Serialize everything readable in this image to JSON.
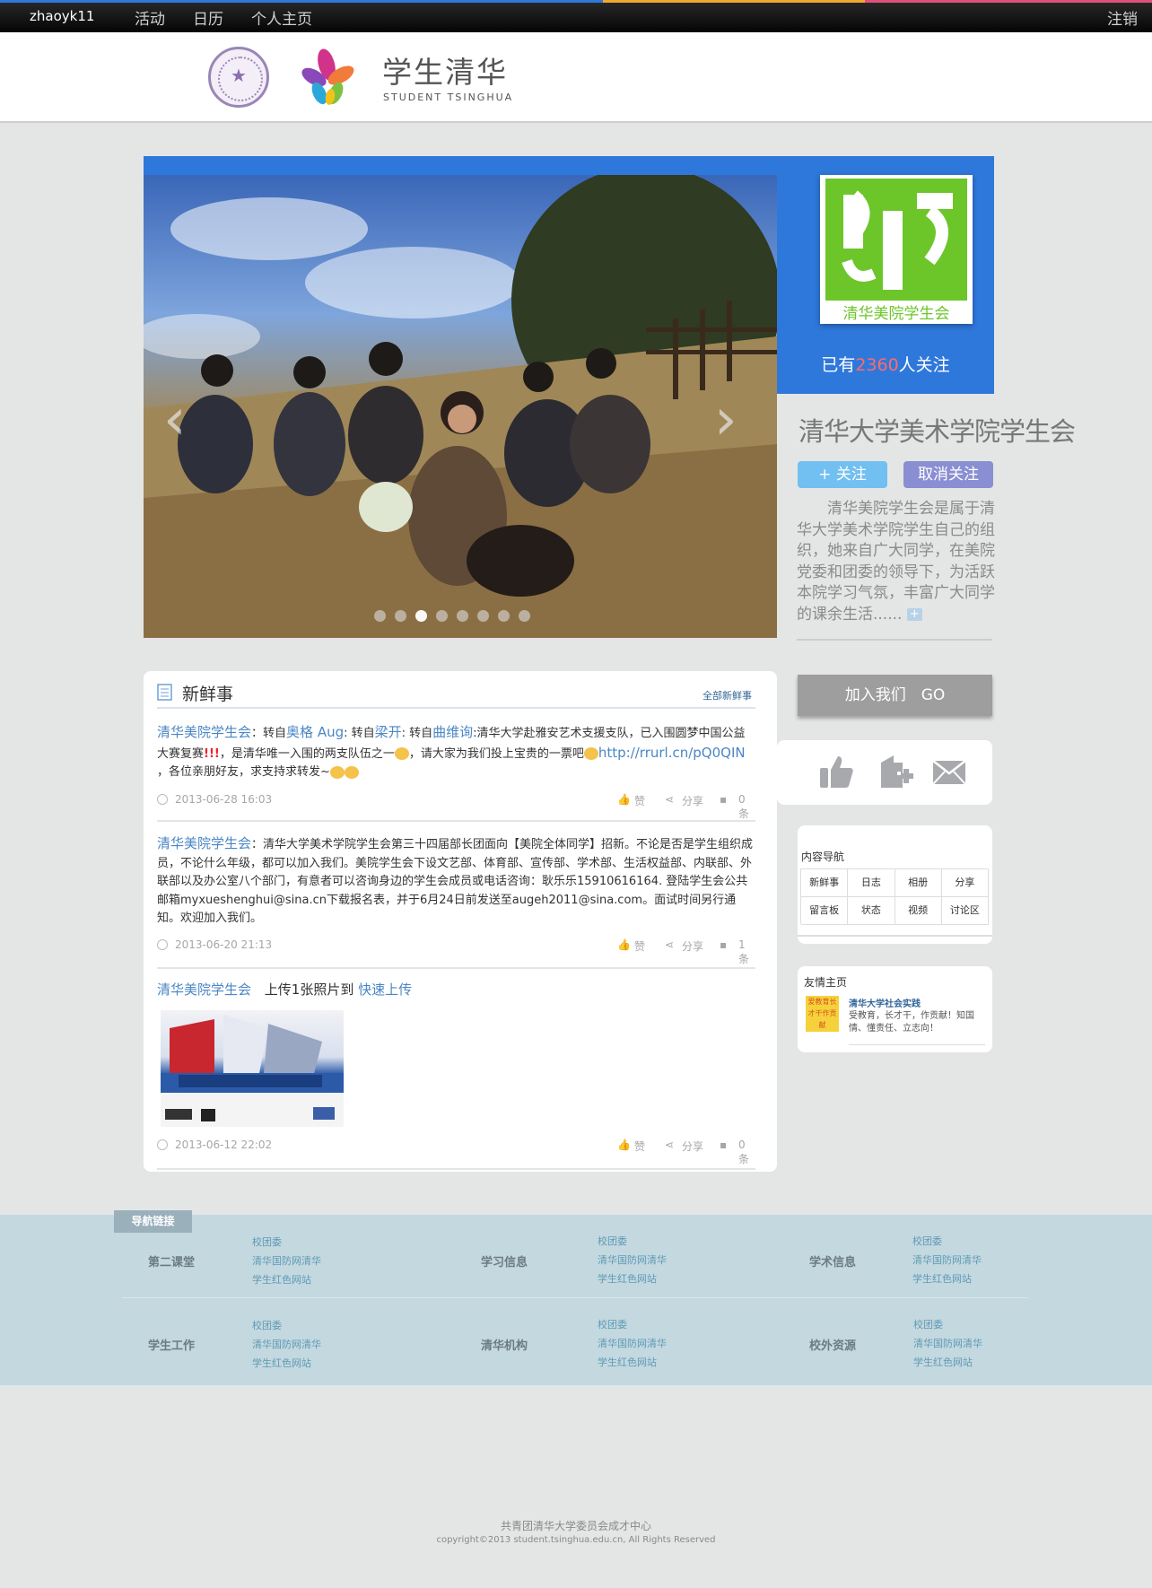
{
  "topbar": {
    "username": "zhaoyk11",
    "nav": [
      "活动",
      "日历",
      "个人主页"
    ],
    "logout": "注销",
    "stripe_colors": [
      "#2f78db",
      "#f0a830",
      "#e0507a"
    ]
  },
  "header": {
    "brand_cn": "学生清华",
    "brand_en": "STUDENT TSINGHUA"
  },
  "profile": {
    "avatar_text": "清华美院学生会",
    "follow_prefix": "已有",
    "follow_count": "2360",
    "follow_suffix": "人关注",
    "org_name": "清华大学美术学院学生会",
    "follow_button": "+ 关注",
    "unfollow_button": "取消关注",
    "intro": "清华美院学生会是属于清华大学美术学院学生自己的组织，她来自广大同学，在美院党委和团委的领导下，为活跃本院学习气氛，丰富广大同学的课余生活......",
    "more_icon": "+"
  },
  "slideshow": {
    "prev_arrow": "‹",
    "next_arrow": "›",
    "dot_count": 8,
    "active_dot": 3
  },
  "feed": {
    "title": "新鲜事",
    "all_link": "全部新鲜事",
    "posts": [
      {
        "author": "清华美院学生会",
        "sep": "：",
        "p1": "转自",
        "u1": "奥格 Aug",
        "p2": ": 转自",
        "u2": "梁开",
        "p3": ": 转自",
        "u3": "曲维询",
        "p4": ":清华大学赴雅安艺术支援支队，已入围圆梦中国公益大赛复赛",
        "excl": "!!!",
        "p5": "，是清华唯一入围的两支队伍之一",
        "p6": "，请大家为我们投上宝贵的一票吧",
        "link": "http://rrurl.cn/pQ0QIN",
        "p7": " ，各位亲朋好友，求支持求转发~",
        "time": "2013-06-28 16:03",
        "like": "赞",
        "share": "分享",
        "comments": "0条"
      },
      {
        "author": "清华美院学生会",
        "sep": "：",
        "text": "清华大学美术学院学生会第三十四届部长团面向【美院全体同学】招新。不论是否是学生组织成员，不论什么年级，都可以加入我们。美院学生会下设文艺部、体育部、宣传部、学术部、生活权益部、内联部、外联部以及办公室八个部门，有意者可以咨询身边的学生会成员或电话咨询：耿乐乐15910616164. 登陆学生会公共邮箱myxueshenghui@sina.cn下载报名表，并于6月24日前发送至augeh2011@sina.com。面试时间另行通知。欢迎加入我们。",
        "time": "2013-06-20 21:13",
        "like": "赞",
        "share": "分享",
        "comments": "1条"
      },
      {
        "author": "清华美院学生会",
        "action": "上传1张照片到",
        "target": "快速上传",
        "time": "2013-06-12 22:02",
        "like": "赞",
        "share": "分享",
        "comments": "0条"
      }
    ]
  },
  "sidebar": {
    "join_button": "加入我们　GO",
    "icons": [
      "thumbs-up-icon",
      "add-page-icon",
      "mail-icon"
    ],
    "content_nav_title": "内容导航",
    "content_nav": [
      "新鲜事",
      "日志",
      "相册",
      "分享",
      "留言板",
      "状态",
      "视频",
      "讨论区"
    ],
    "friend_title": "友情主页",
    "friend_logo_text": "爱教育长才干作贡献",
    "friend_name": "清华大学社会实践",
    "friend_desc": "受教育，长才干，作贡献！知国情、懂责任、立志向！"
  },
  "footer_nav": {
    "tag": "导航链接",
    "rows": [
      [
        {
          "category": "第二课堂",
          "links": [
            "校团委",
            "清华国防网清华",
            "学生红色网站"
          ]
        },
        {
          "category": "学习信息",
          "links": [
            "校团委",
            "清华国防网清华",
            "学生红色网站"
          ]
        },
        {
          "category": "学术信息",
          "links": [
            "校团委",
            "清华国防网清华",
            "学生红色网站"
          ]
        }
      ],
      [
        {
          "category": "学生工作",
          "links": [
            "校团委",
            "清华国防网清华",
            "学生红色网站"
          ]
        },
        {
          "category": "清华机构",
          "links": [
            "校团委",
            "清华国防网清华",
            "学生红色网站"
          ]
        },
        {
          "category": "校外资源",
          "links": [
            "校团委",
            "清华国防网清华",
            "学生红色网站"
          ]
        }
      ]
    ]
  },
  "footer": {
    "line1": "共青团清华大学委员会成才中心",
    "line2": "copyright©2013 student.tsinghua.edu.cn, All Rights Reserved"
  }
}
